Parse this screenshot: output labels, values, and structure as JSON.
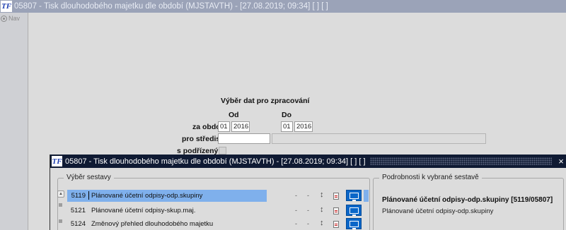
{
  "window": {
    "logo": "TF",
    "title": "05807 - Tisk dlouhodobého majetku dle období (MJSTAVTH) - [27.08.2019; 09:34]  [ ]  [ ]"
  },
  "nav": {
    "label": "Nav",
    "icon": "compass-icon"
  },
  "form": {
    "section_title": "Výběr dat pro zpracování",
    "col_from": "Od",
    "col_to": "Do",
    "period_label": "za období",
    "from_month": "01",
    "from_year": "2016",
    "to_month": "01",
    "to_year": "2016",
    "center_label": "pro středisko",
    "center_value": "",
    "center_desc": "",
    "subordinates_label": "s podřízenými",
    "subordinates_checked": false
  },
  "dialog": {
    "logo": "TF",
    "title": "05807 - Tisk dlouhodobého majetku dle období (MJSTAVTH) - [27.08.2019; 09:34]  [ ]  [ ]",
    "close_label": "×",
    "reports_group_label": "Výběr sestavy",
    "details_group_label": "Podrobnosti k vybrané sestavě",
    "reports": [
      {
        "code": "5119",
        "name": "Plánované účetní odpisy-odp.skupiny",
        "dash1": "-",
        "dash2": "-"
      },
      {
        "code": "5121",
        "name": "Plánované účetní odpisy-skup.maj.",
        "dash1": "-",
        "dash2": "-"
      },
      {
        "code": "5124",
        "name": "Změnový přehled dlouhodobého majetku",
        "dash1": "-",
        "dash2": "-"
      }
    ],
    "detail_title": "Plánované účetní odpisy-odp.skupiny [5119/05807]",
    "detail_desc": "Plánované účetní odpisy-odp.skupiny"
  },
  "colors": {
    "outer_title_bg": "#9ba3b8",
    "inner_title_bg": "#0f1a33",
    "selection": "#7fb0ec",
    "monitor_button": "#0a66c8"
  }
}
